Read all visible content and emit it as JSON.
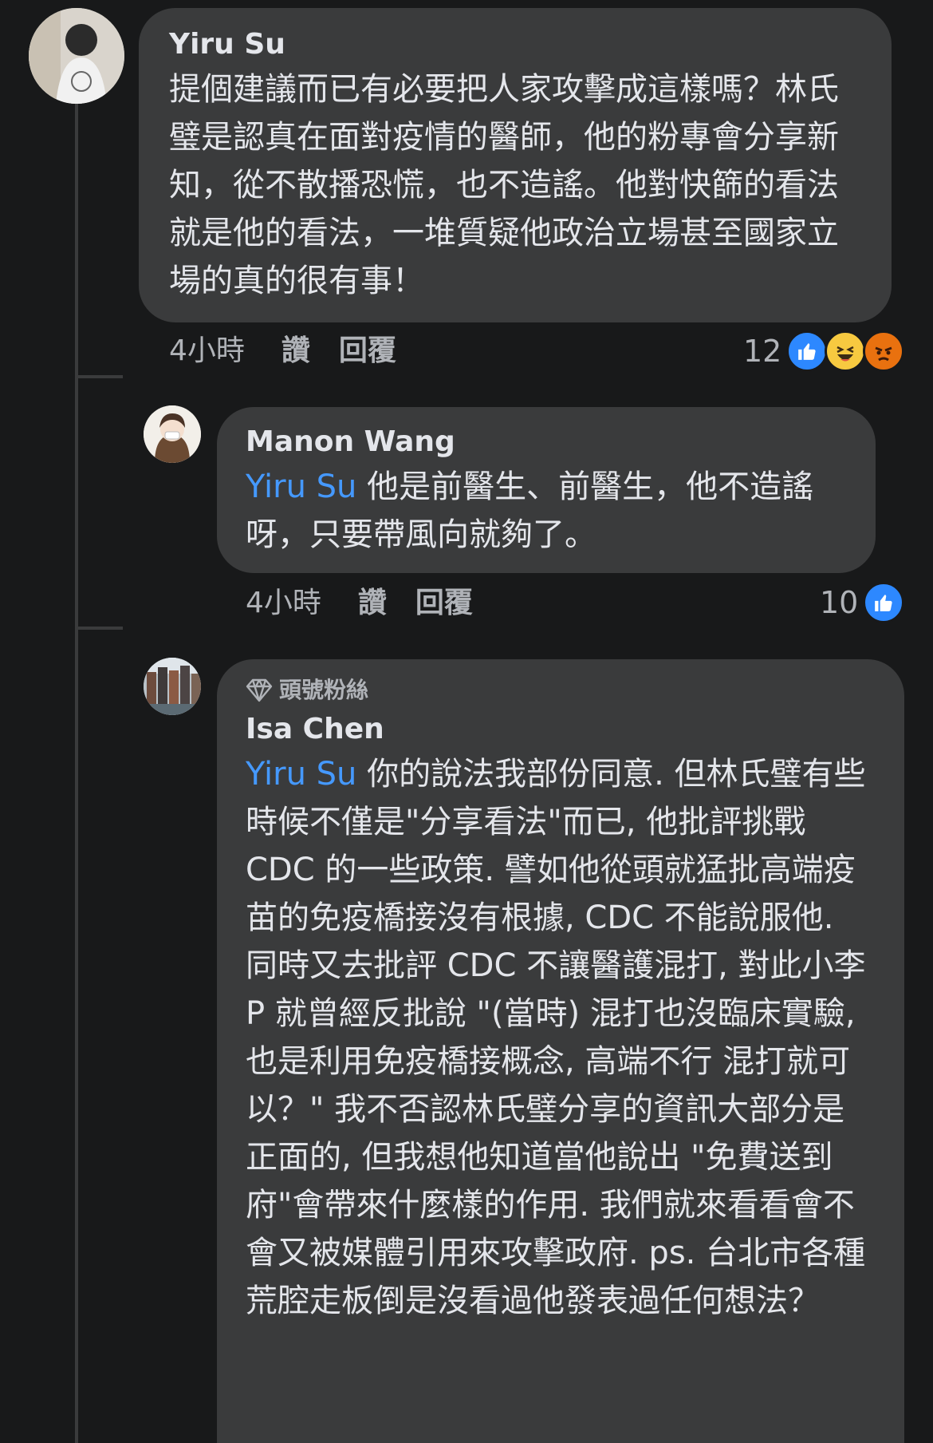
{
  "comments": [
    {
      "author": "Yiru Su",
      "text": "提個建議而已有必要把人家攻擊成這樣嗎？林氏璧是認真在面對疫情的醫師，他的粉專會分享新知，從不散播恐慌，也不造謠。他對快篩的看法就是他的看法，一堆質疑他政治立場甚至國家立場的真的很有事！",
      "time": "4小時",
      "like_label": "讚",
      "reply_label": "回覆",
      "reaction_count": "12",
      "reactions": [
        "like-icon",
        "haha-icon",
        "angry-icon"
      ]
    },
    {
      "author": "Manon Wang",
      "mention": "Yiru Su",
      "text": "他是前醫生、前醫生，他不造謠呀，只要帶風向就夠了。",
      "time": "4小時",
      "like_label": "讚",
      "reply_label": "回覆",
      "reaction_count": "10",
      "reactions": [
        "like-icon"
      ]
    },
    {
      "badge": "頭號粉絲",
      "author": "Isa Chen",
      "mention": "Yiru Su",
      "text": "你的說法我部份同意. 但林氏璧有些時候不僅是\"分享看法\"而已, 他批評挑戰 CDC 的一些政策. 譬如他從頭就猛批高端疫苗的免疫橋接沒有根據, CDC 不能說服他. 同時又去批評 CDC 不讓醫護混打, 對此小李 P 就曾經反批說 \"(當時) 混打也沒臨床實驗, 也是利用免疫橋接概念, 高端不行 混打就可以？\" 我不否認林氏璧分享的資訊大部分是正面的, 但我想他知道當他說出 \"免費送到府\"會帶來什麼樣的作用. 我們就來看看會不會又被媒體引用來攻擊政府. ps. 台北市各種荒腔走板倒是沒看過他發表過任何想法？"
    }
  ],
  "colors": {
    "background": "#18191a",
    "bubble": "#3a3b3c",
    "mention": "#4599ff",
    "like": "#2d88ff"
  }
}
